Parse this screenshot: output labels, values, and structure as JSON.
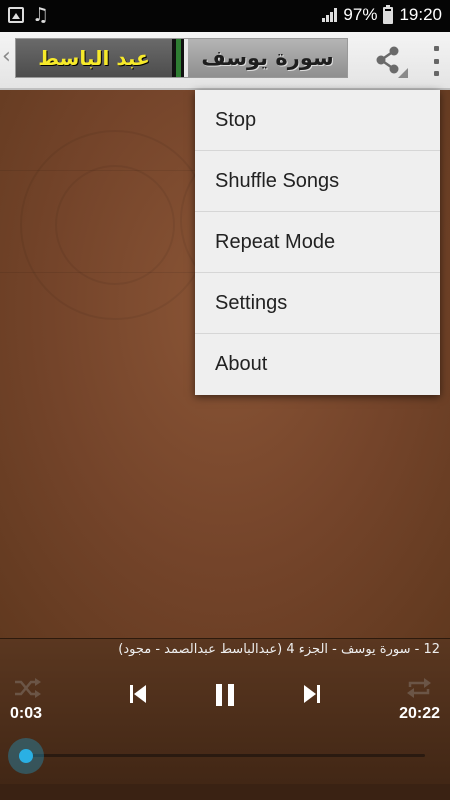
{
  "status_bar": {
    "battery": "97%",
    "time": "19:20",
    "icons": [
      "image-icon",
      "music-note-icon",
      "signal-icon",
      "battery-icon"
    ]
  },
  "action_bar": {
    "logo_left_text": "عبد الباسط",
    "logo_right_text": "سورة يوسف",
    "icons": [
      "back-chevron-icon",
      "share-icon",
      "overflow-menu-icon"
    ]
  },
  "menu": {
    "items": [
      "Stop",
      "Shuffle Songs",
      "Repeat Mode",
      "Settings",
      "About"
    ]
  },
  "player": {
    "track_title": "12 - سورة يوسف - الجزء 4 (عبدالباسط عبدالصمد - مجود)",
    "elapsed": "0:03",
    "duration": "20:22",
    "progress_fraction": 0.0025,
    "icons": [
      "shuffle-icon",
      "previous-icon",
      "pause-icon",
      "next-icon",
      "repeat-icon"
    ]
  },
  "colors": {
    "accent": "#2ab0e4",
    "logo_text": "#f7ea2a",
    "background": "#74442a"
  }
}
